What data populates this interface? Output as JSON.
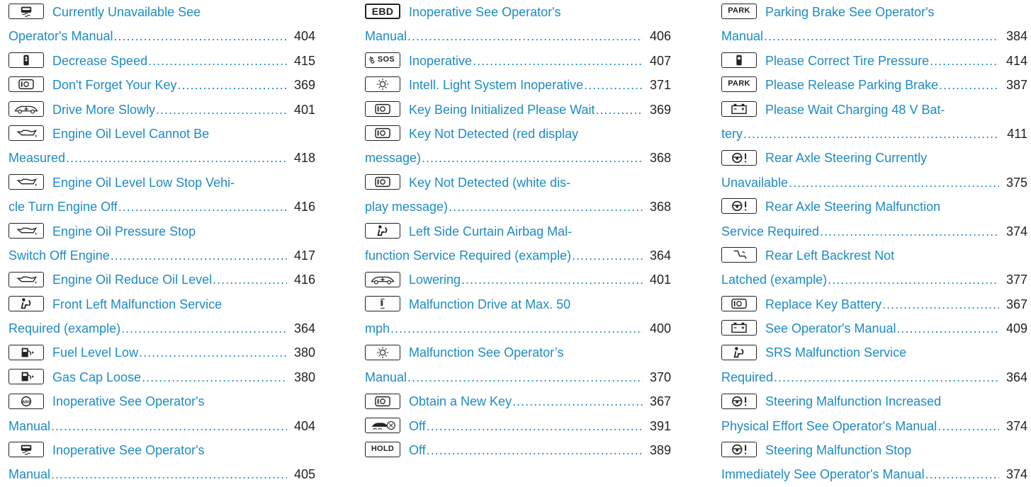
{
  "columns": [
    {
      "entries": [
        {
          "icon": "car-front-icon",
          "lines": [
            "Currently Unavailable See",
            "Operator's Manual"
          ],
          "page": "404"
        },
        {
          "icon": "traffic-light-icon",
          "lines": [
            "Decrease Speed"
          ],
          "page": "415"
        },
        {
          "icon": "key-icon",
          "lines": [
            "Don't Forget Your Key"
          ],
          "page": "369"
        },
        {
          "icon": "car-lowering-icon",
          "lines": [
            "Drive More Slowly"
          ],
          "page": "401"
        },
        {
          "icon": "oil-can-icon",
          "lines": [
            "Engine Oil Level Cannot Be",
            "Measured"
          ],
          "page": "418"
        },
        {
          "icon": "oil-can-icon",
          "lines": [
            "Engine Oil Level Low Stop Vehi-",
            "cle Turn Engine Off"
          ],
          "page": "416"
        },
        {
          "icon": "oil-can-icon",
          "lines": [
            "Engine Oil Pressure Stop",
            "Switch Off Engine"
          ],
          "page": "417"
        },
        {
          "icon": "oil-can-icon",
          "lines": [
            "Engine Oil Reduce Oil Level"
          ],
          "page": "416"
        },
        {
          "icon": "airbag-icon",
          "lines": [
            "Front Left Malfunction Service",
            "Required (example)"
          ],
          "page": "364"
        },
        {
          "icon": "fuel-pump-icon",
          "lines": [
            "Fuel Level Low"
          ],
          "page": "380"
        },
        {
          "icon": "fuel-pump-icon",
          "lines": [
            "Gas Cap Loose"
          ],
          "page": "380"
        },
        {
          "icon": "abs-icon",
          "lines": [
            "Inoperative See Operator's",
            "Manual"
          ],
          "page": "404"
        },
        {
          "icon": "car-front-icon",
          "lines": [
            "Inoperative See Operator's",
            "Manual"
          ],
          "page": "405"
        }
      ]
    },
    {
      "entries": [
        {
          "icon": "ebd-icon",
          "icon_text": "EBD",
          "lines": [
            "Inoperative See Operator's",
            "Manual"
          ],
          "page": "406"
        },
        {
          "icon": "sos-icon",
          "icon_text": "SOS",
          "lines": [
            "Inoperative"
          ],
          "page": "407"
        },
        {
          "icon": "light-icon",
          "lines": [
            "Intell. Light System Inoperative"
          ],
          "page": "371"
        },
        {
          "icon": "key-icon",
          "lines": [
            "Key Being Initialized Please Wait"
          ],
          "page": "369"
        },
        {
          "icon": "key-icon",
          "lines": [
            "Key Not Detected  (red display",
            "message)"
          ],
          "page": "368"
        },
        {
          "icon": "key-icon",
          "lines": [
            "Key Not Detected  (white dis-",
            "play message)"
          ],
          "page": "368"
        },
        {
          "icon": "airbag-icon",
          "lines": [
            "Left Side Curtain Airbag Mal-",
            "function Service Required (example)"
          ],
          "page": "364"
        },
        {
          "icon": "car-lowering-icon",
          "lines": [
            "Lowering"
          ],
          "page": "401"
        },
        {
          "icon": "suspension-icon",
          "lines": [
            "Malfunction Drive at Max. 50",
            "mph"
          ],
          "page": "400"
        },
        {
          "icon": "light-icon",
          "lines": [
            "Malfunction See Operator’s",
            "Manual"
          ],
          "page": "370"
        },
        {
          "icon": "key-icon",
          "lines": [
            "Obtain a New Key"
          ],
          "page": "367"
        },
        {
          "icon": "esp-off-icon",
          "lines": [
            "Off"
          ],
          "page": "391"
        },
        {
          "icon": "hold-icon",
          "icon_text": "HOLD",
          "lines": [
            "Off"
          ],
          "page": "389"
        }
      ]
    },
    {
      "entries": [
        {
          "icon": "park-icon",
          "icon_text": "PARK",
          "lines": [
            "Parking Brake See Operator's",
            "Manual"
          ],
          "page": "384"
        },
        {
          "icon": "tire-pressure-icon",
          "lines": [
            "Please Correct Tire Pressure"
          ],
          "page": "414"
        },
        {
          "icon": "park-icon",
          "icon_text": "PARK",
          "lines": [
            "Please Release Parking Brake"
          ],
          "page": "387"
        },
        {
          "icon": "battery-icon",
          "lines": [
            "Please Wait Charging 48 V Bat-",
            "tery"
          ],
          "page": "411"
        },
        {
          "icon": "steering-icon",
          "lines": [
            "Rear Axle Steering Currently",
            "Unavailable"
          ],
          "page": "375"
        },
        {
          "icon": "steering-icon",
          "lines": [
            "Rear Axle Steering Malfunction",
            "Service Required"
          ],
          "page": "374"
        },
        {
          "icon": "backrest-icon",
          "lines": [
            "Rear Left Backrest Not",
            "Latched (example)"
          ],
          "page": "377"
        },
        {
          "icon": "key-icon",
          "lines": [
            "Replace Key Battery"
          ],
          "page": "367"
        },
        {
          "icon": "battery-icon",
          "lines": [
            "See Operator's Manual"
          ],
          "page": "409"
        },
        {
          "icon": "airbag-icon",
          "lines": [
            "SRS Malfunction Service",
            "Required"
          ],
          "page": "364"
        },
        {
          "icon": "steering-icon",
          "lines": [
            "Steering Malfunction Increased",
            "Physical Effort See Operator's Manual"
          ],
          "page": "374"
        },
        {
          "icon": "steering-icon",
          "lines": [
            "Steering Malfunction Stop",
            "Immediately See Operator's Manual"
          ],
          "page": "374"
        }
      ]
    }
  ],
  "colors": {
    "link": "#1d8bc4",
    "text": "#222222",
    "icon_border": "#222222"
  }
}
